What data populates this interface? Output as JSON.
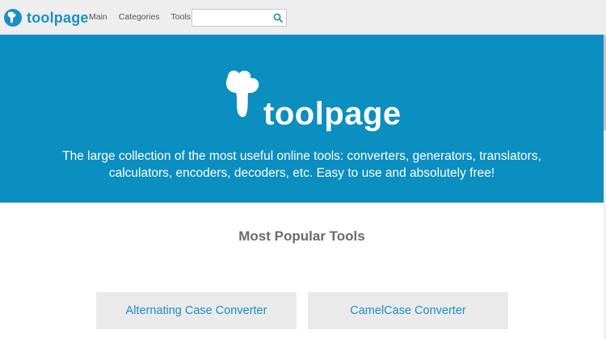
{
  "navbar": {
    "brand": "toolpage",
    "links": [
      "Main",
      "Categories",
      "Tools"
    ],
    "search": {
      "value": "",
      "placeholder": ""
    }
  },
  "hero": {
    "brand": "toolpage",
    "description_line1": "The large collection of the most useful online tools: converters, generators, translators,",
    "description_line2": "calculators, encoders, decoders, etc. Easy to use and absolutely free!"
  },
  "popular": {
    "title": "Most Popular Tools",
    "tools": [
      "Alternating Case Converter",
      "CamelCase Converter"
    ]
  },
  "colors": {
    "brand": "#1a8fc4",
    "hero_bg": "#0b8ec0",
    "navbar_bg": "#eeeeee",
    "card_bg": "#eaeaea"
  },
  "icons": {
    "brand_logo": "toolpage-logo-icon",
    "search": "search-icon"
  }
}
